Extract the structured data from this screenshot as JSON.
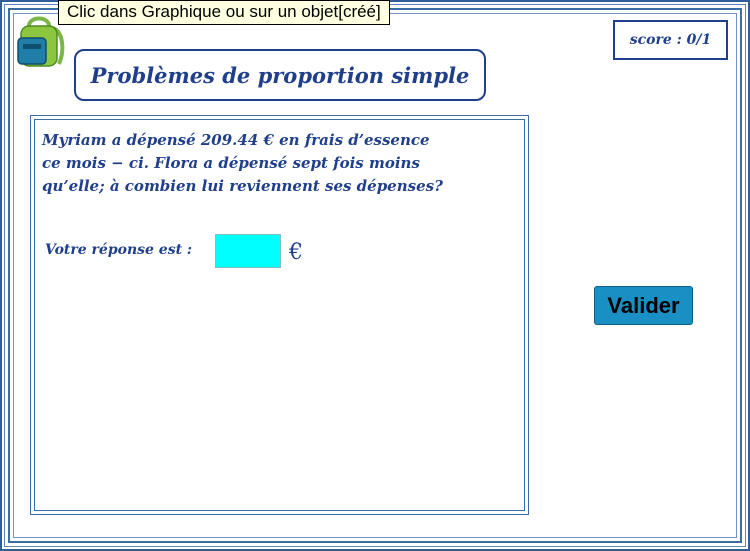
{
  "tooltip": "Clic dans Graphique ou sur un objet[créé]",
  "score": "score : 0/1",
  "title": "Problèmes de proportion simple",
  "problem": {
    "lines": [
      "Myriam a dépensé 209.44 € en frais d’essence",
      "ce mois − ci. Flora a dépensé sept fois moins",
      "qu’elle; à combien lui reviennent ses dépenses?"
    ]
  },
  "answer": {
    "label": "Votre réponse est :",
    "value": "",
    "unit": "€"
  },
  "validate_label": "Valider",
  "icons": {
    "bag": "school-bag-icon"
  },
  "colors": {
    "accent": "#1f3f8a",
    "frame": "#3a6da6",
    "input_bg": "#00ffff",
    "button_bg": "#1a8fc4"
  }
}
